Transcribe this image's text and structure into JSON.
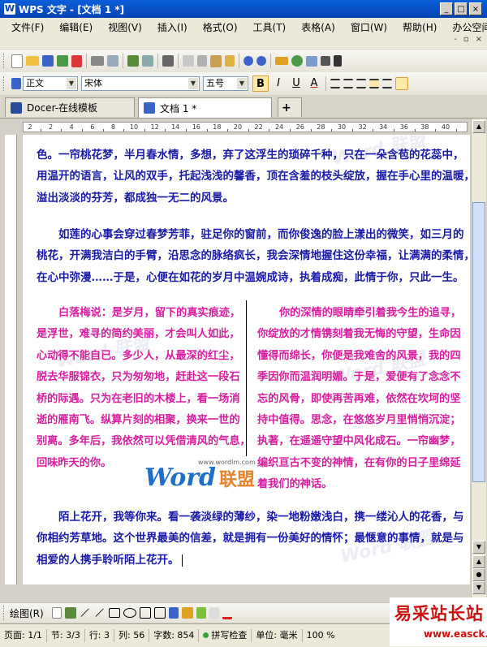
{
  "window": {
    "title": "WPS 文字 - [文档 1 *]",
    "logo": "W",
    "minimize": "_",
    "maximize": "□",
    "close": "×"
  },
  "menu": {
    "items": [
      "文件(F)",
      "编辑(E)",
      "视图(V)",
      "插入(I)",
      "格式(O)",
      "工具(T)",
      "表格(A)",
      "窗口(W)",
      "帮助(H)",
      "办公空间(K)"
    ],
    "doc_min": "-",
    "doc_restore": "▫",
    "doc_close": "×"
  },
  "format_toolbar": {
    "style": "正文",
    "font": "宋体",
    "size": "五号",
    "bold": "B",
    "italic": "I",
    "underline": "U",
    "font_color": "A"
  },
  "tabs": [
    {
      "label": "Docer-在线模板"
    },
    {
      "label": "文档 1 *"
    }
  ],
  "tab_add": "+",
  "ruler": {
    "ticks": [
      "2",
      "2",
      "4",
      "6",
      "8",
      "10",
      "12",
      "14",
      "16",
      "18",
      "20",
      "22",
      "24",
      "26",
      "28",
      "30",
      "32",
      "34",
      "36",
      "38",
      "40"
    ]
  },
  "document": {
    "para1": [
      "色。一帘桃花梦，半月春水情，多想，弃了这浮生的琐碎千种，只在一朵含苞的花蕊中，",
      "用温开的语言，让风的双手，托起浅浅的馨香，顶在含羞的枝头绽放，握在手心里的温暖，",
      "溢出淡淡的芬芳，都成独一无二的风景。"
    ],
    "para2": [
      "如莲的心事会穿过春梦芳菲，驻足你的窗前，而你俊逸的脸上漾出的微笑，如三月的",
      "桃花，开满我洁白的手臂，沿思念的脉络疯长，我会深情地握住这份幸福，让满满的柔情，",
      "在心中弥漫……于是，心便在如花的岁月中温婉成诗，执着成痴，此情于你，只此一生。"
    ],
    "col_left": [
      "白落梅说：是岁月，留下的真实痕迹，",
      "是浮世，难寻的简约美丽，才会叫人如此，",
      "心动得不能自已。多少人，从最深的红尘，",
      "脱去华服锦衣，只为匆匆地，赶赴这一段石",
      "桥的际遇。只为在老旧的木楼上，看一场消",
      "逝的雁南飞。纵算片刻的相聚，换来一世的",
      "别离。多年后，我依然可以凭借清风的气息，",
      "回味昨天的你。"
    ],
    "col_right": [
      "你的深情的眼睛牵引着我今生的追寻，",
      "你绽放的才情镌刻着我无悔的守望，生命因",
      "懂得而绵长，你便是我难舍的风景，我的四",
      "季因你而温润明媚。于是，爱便有了念念不",
      "忘的风骨，即使再苦再难，依然在坎坷的坚",
      "持中值得。思念，在悠悠岁月里悄悄沉淀；",
      "执著，在遥遥守望中风化成石。一帘幽梦，",
      "编织亘古不变的神情，在有你的日子里绵延",
      "着我们的神话。"
    ],
    "para3": [
      "陌上花开，我等你来。看一袭淡绿的薄纱，染一地粉嫩浅白，携一缕沁人的花香，与",
      "你相约芳草地。这个世界最美的信差，就是拥有一份美好的情怀；最惬意的事情，就是与",
      "相爱的人携手聆听陌上花开。"
    ]
  },
  "watermark": {
    "url": "www.wordlm.com",
    "word": "Word",
    "cn": "联盟"
  },
  "drawbar": {
    "label": "绘图(R)"
  },
  "status": {
    "page": "页面: 1/1",
    "section": "节: 3/3",
    "row": "行: 3",
    "col": "列: 56",
    "chars": "字数: 854",
    "spell": "拼写检查",
    "unit": "单位: 毫米",
    "zoom": "100 %"
  },
  "site_stamp": {
    "cn": "易采站长站",
    "url": "www.easck.com"
  }
}
